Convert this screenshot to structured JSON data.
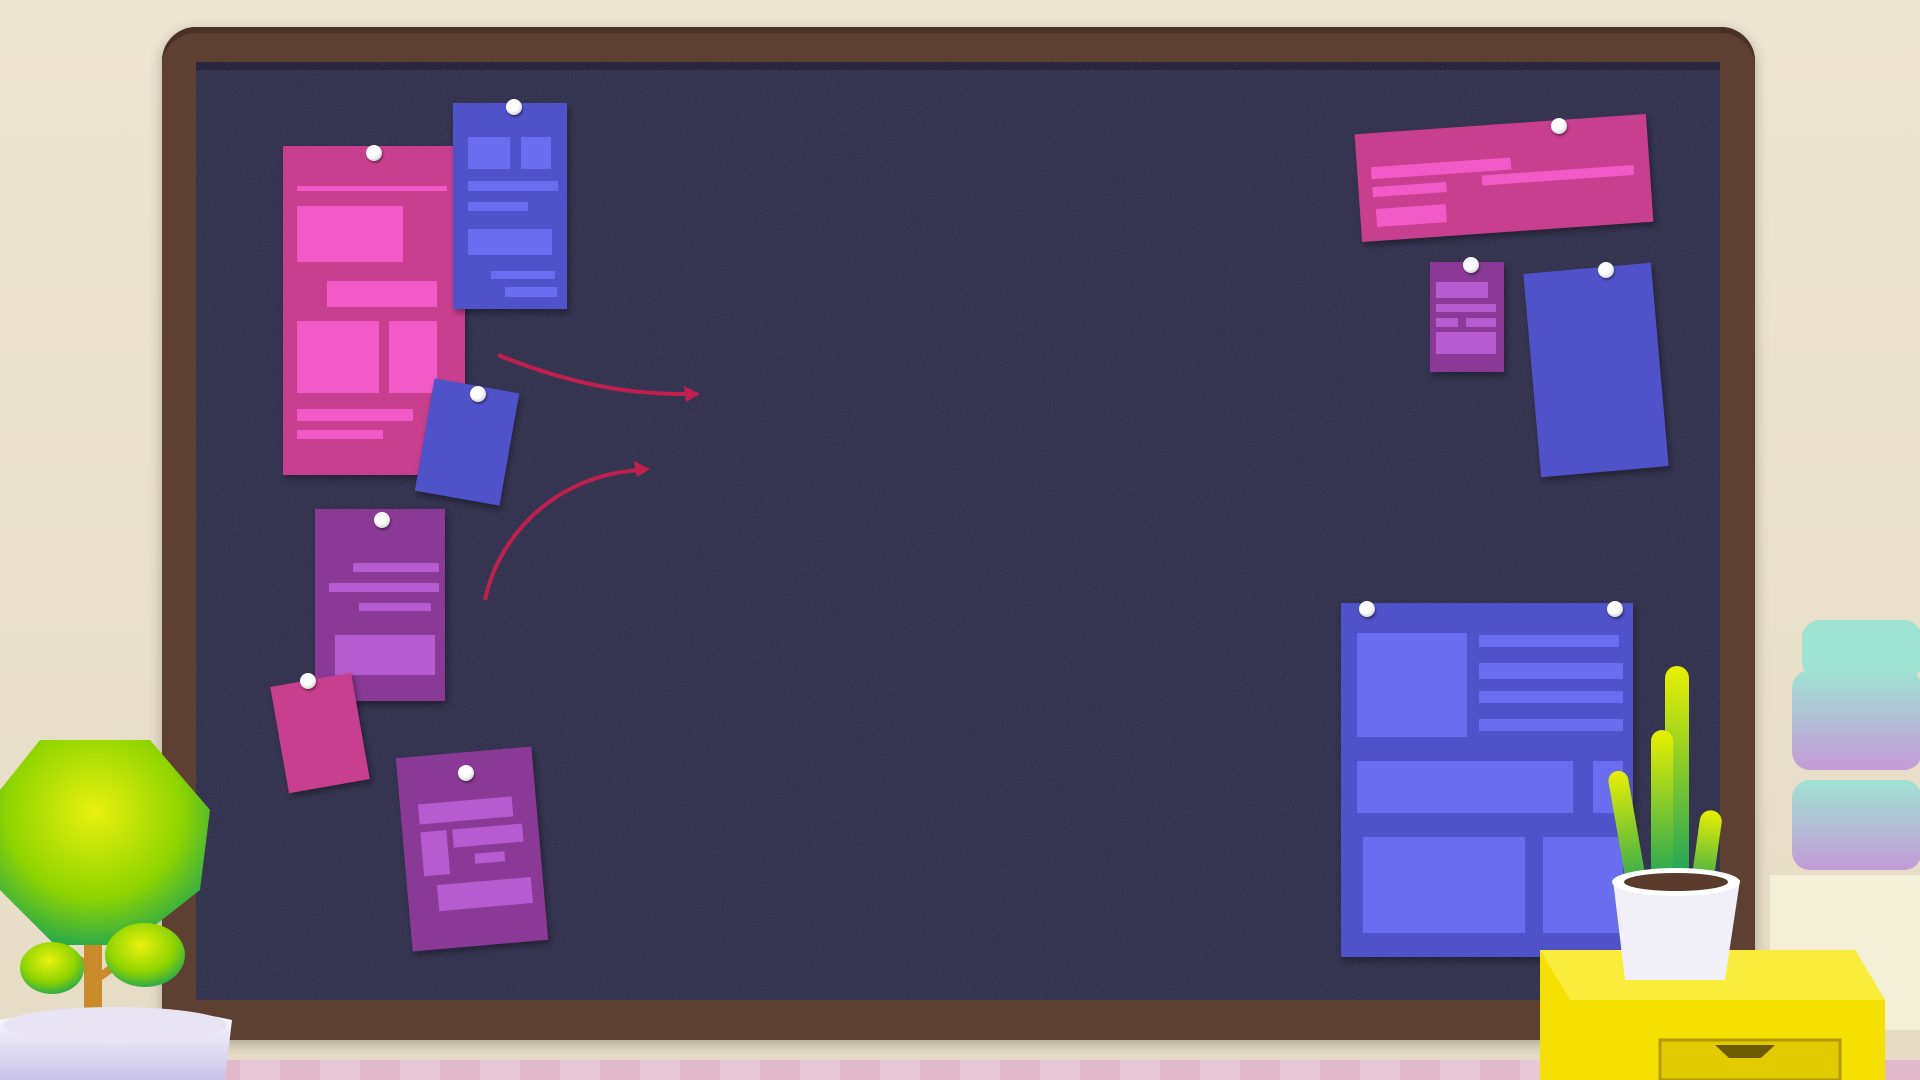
{
  "scene": {
    "type": "empty corkboard background",
    "colors": {
      "wall": "#ece3cf",
      "frame": "#5e4033",
      "cork": "#25243f",
      "note_pink": "#c93f8f",
      "note_blue": "#5052c9",
      "note_purple": "#8a3a96",
      "arrow": "#c21f4e",
      "plant_green": "#7fd400",
      "box_yellow": "#f5e000"
    },
    "notes": {
      "left_cluster": [
        "pink-tall-note",
        "blue-note-top",
        "blue-small-note",
        "purple-note-mid",
        "pink-small-note",
        "purple-note-bottom"
      ],
      "right_cluster": [
        "pink-wide-note",
        "purple-small-note",
        "blue-crumpled-note",
        "blue-large-note"
      ]
    },
    "decorations": [
      "tree-plant-icon",
      "cactus-plant-icon",
      "yellow-drawer-box",
      "stacked-cylinders"
    ]
  }
}
